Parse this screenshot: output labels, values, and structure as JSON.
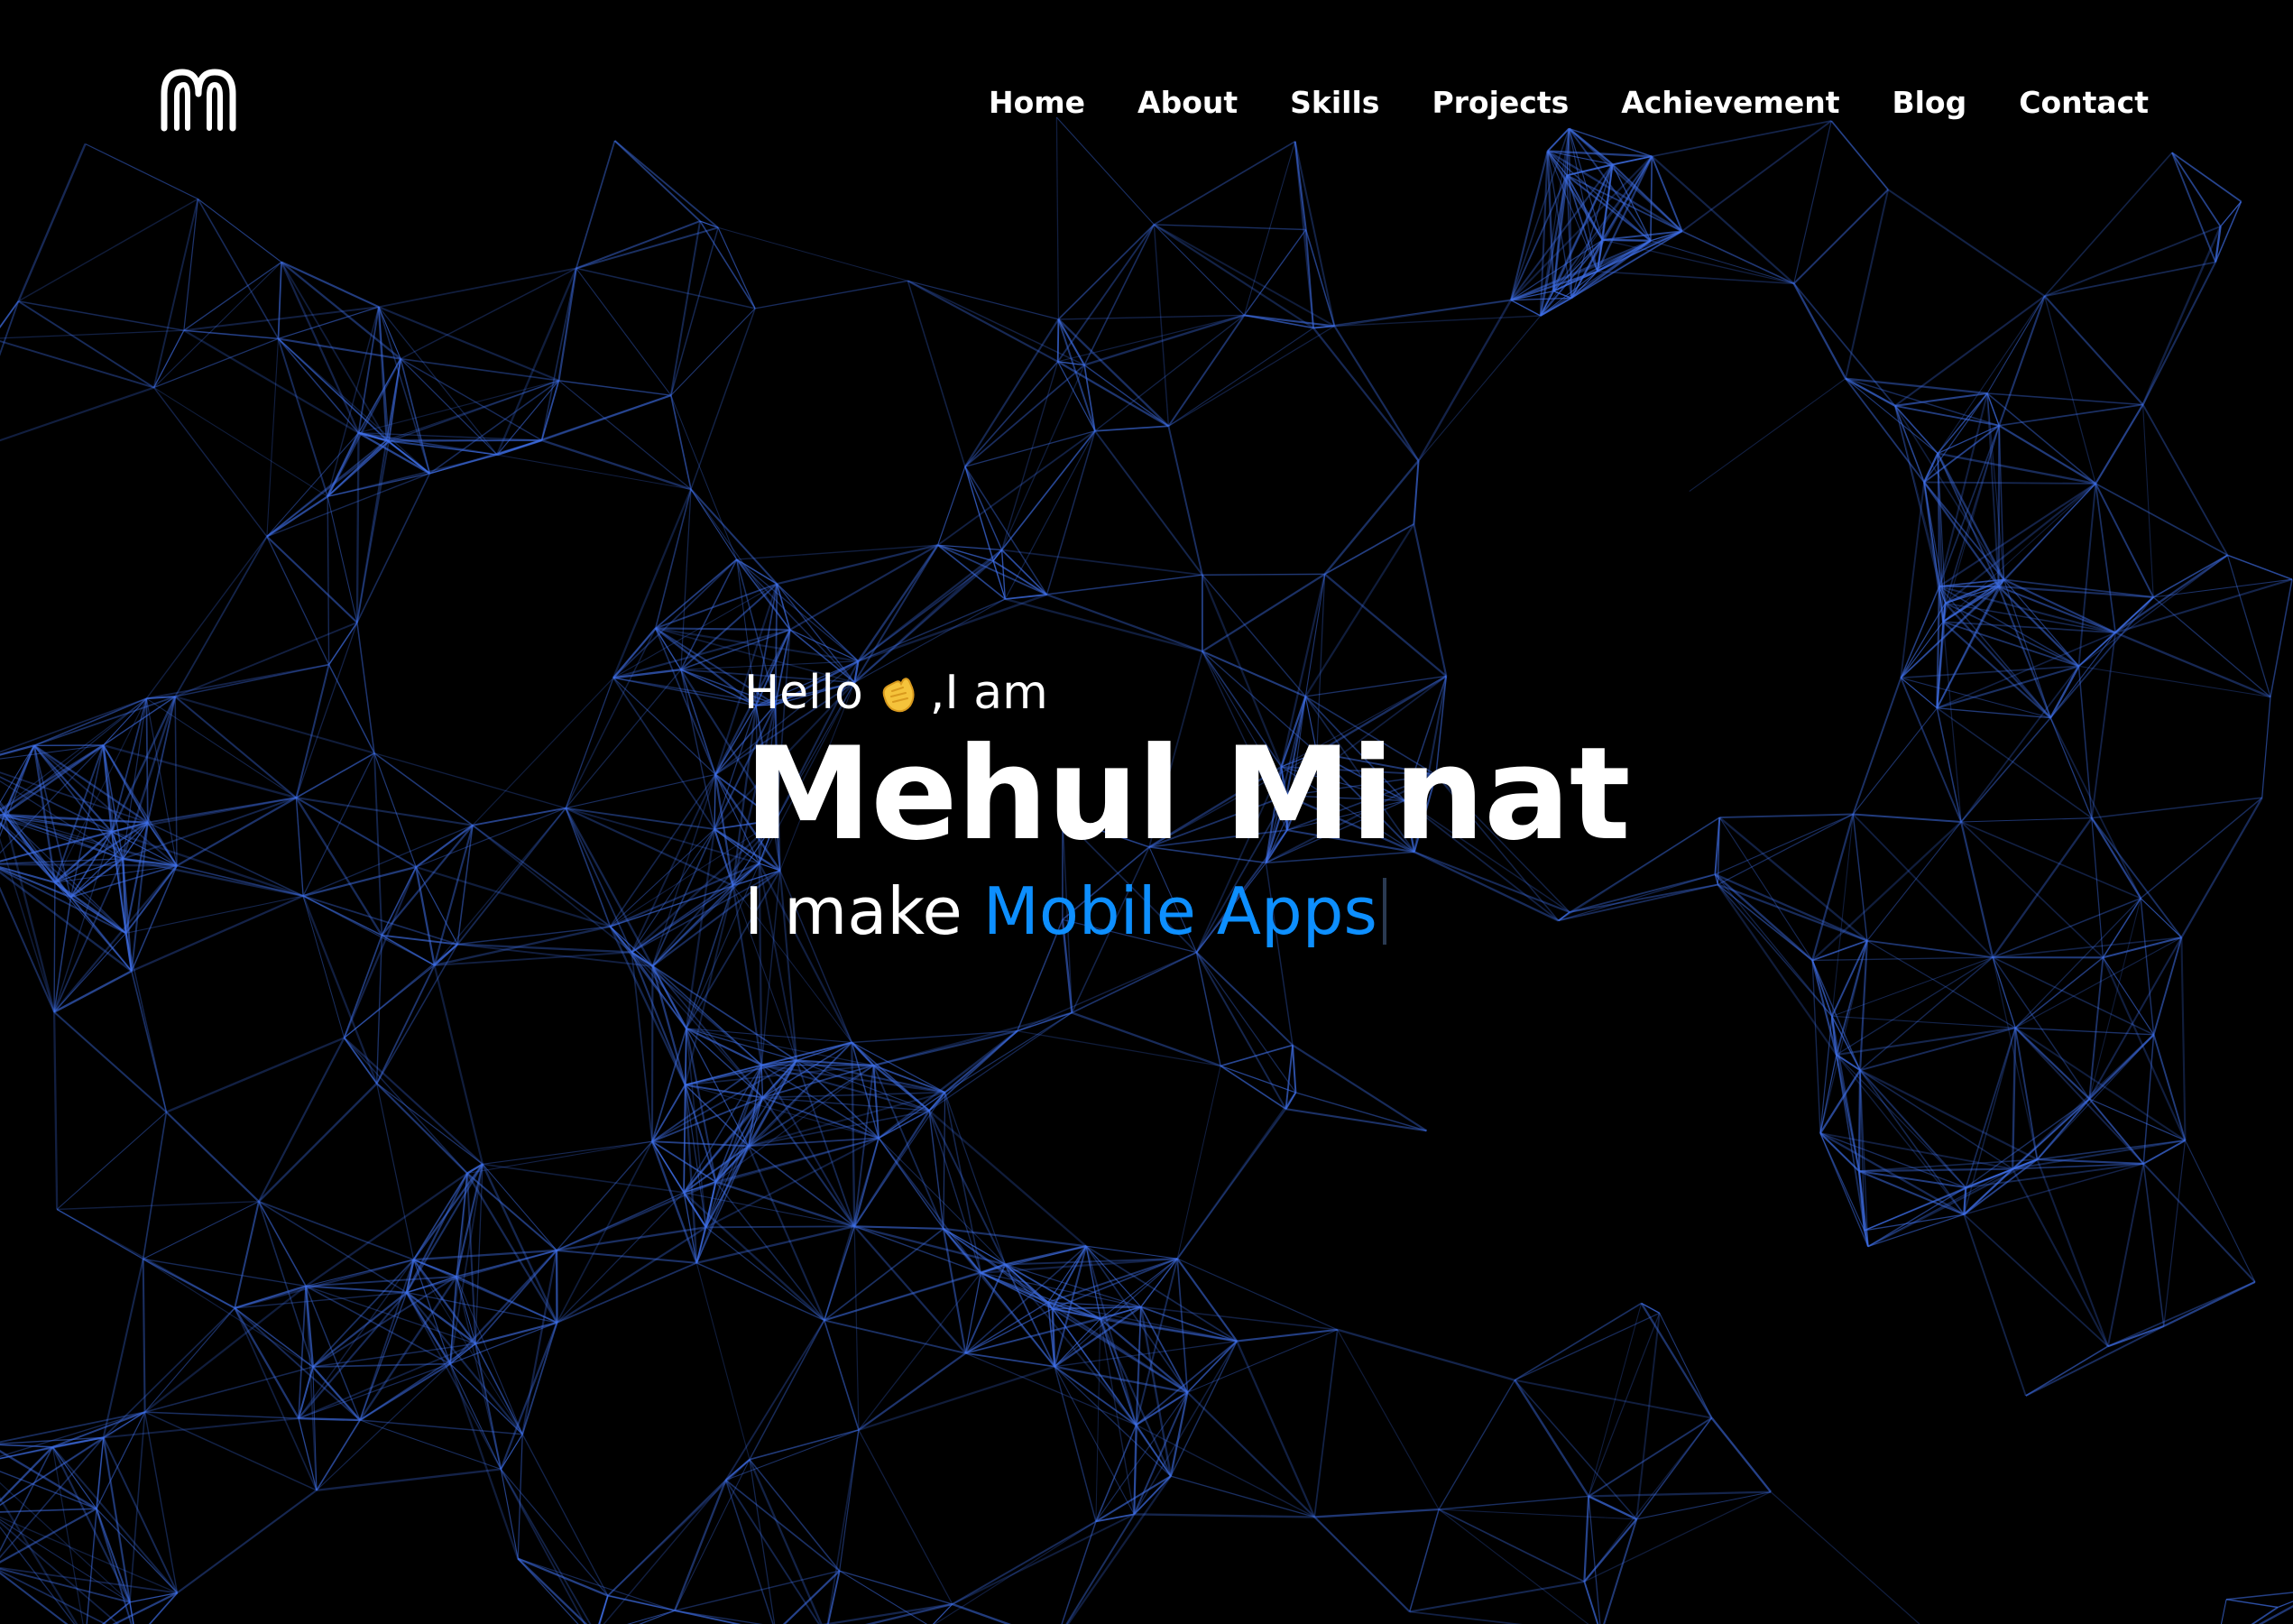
{
  "theme": {
    "background": "#000000",
    "network_line": "#3f6fe8",
    "accent": "#0d8fff",
    "text": "#ffffff"
  },
  "header": {
    "logo_icon": "m-logo-icon",
    "nav": [
      {
        "label": "Home"
      },
      {
        "label": "About"
      },
      {
        "label": "Skills"
      },
      {
        "label": "Projects"
      },
      {
        "label": "Achievement"
      },
      {
        "label": "Blog"
      },
      {
        "label": "Contact"
      }
    ]
  },
  "hero": {
    "greeting_prefix": "Hello",
    "greeting_emoji_icon": "waving-hand-icon",
    "greeting_suffix": ",I am",
    "name": "Mehul Minat",
    "tagline_prefix": "I make ",
    "tagline_highlight": "Mobile Apps"
  }
}
